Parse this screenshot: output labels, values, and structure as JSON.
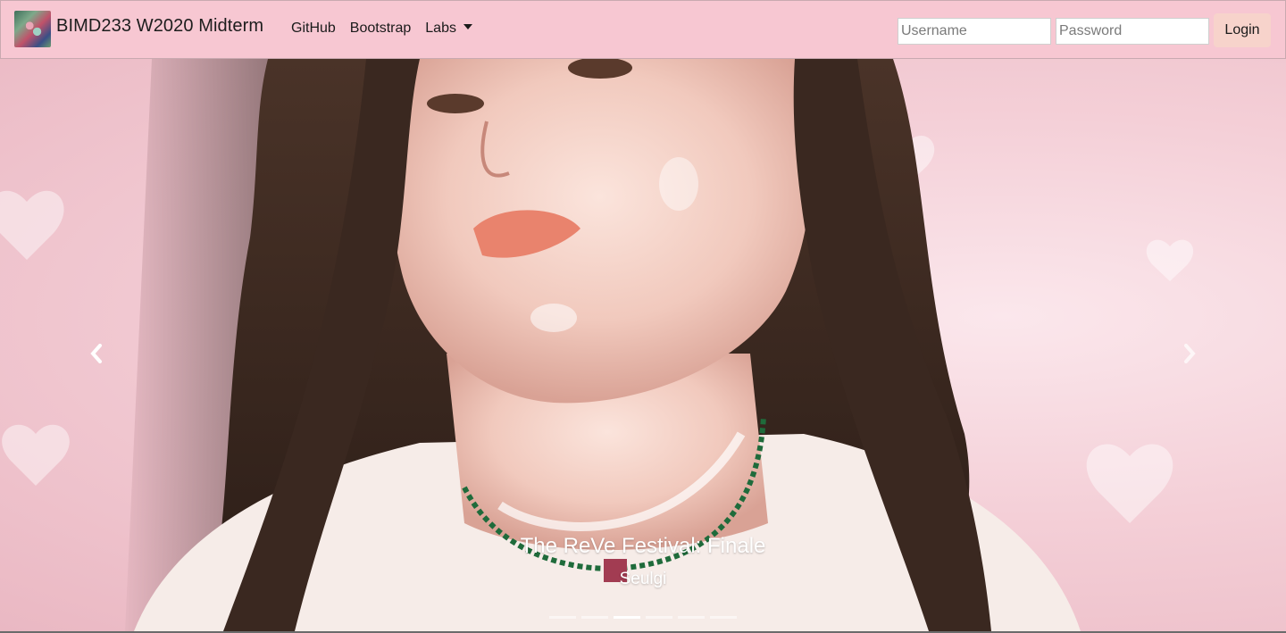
{
  "navbar": {
    "brand": "BIMD233 W2020 Midterm",
    "links": [
      "GitHub",
      "Bootstrap",
      "Labs"
    ],
    "username_placeholder": "Username",
    "password_placeholder": "Password",
    "login_label": "Login",
    "background": "#f7c7d2"
  },
  "carousel": {
    "caption_title": "The ReVe Festival: Finale",
    "caption_subtitle": "Seulgi",
    "active_index": 2,
    "indicator_count": 6,
    "icons": {
      "prev": "chevron-left-icon",
      "next": "chevron-right-icon"
    }
  }
}
